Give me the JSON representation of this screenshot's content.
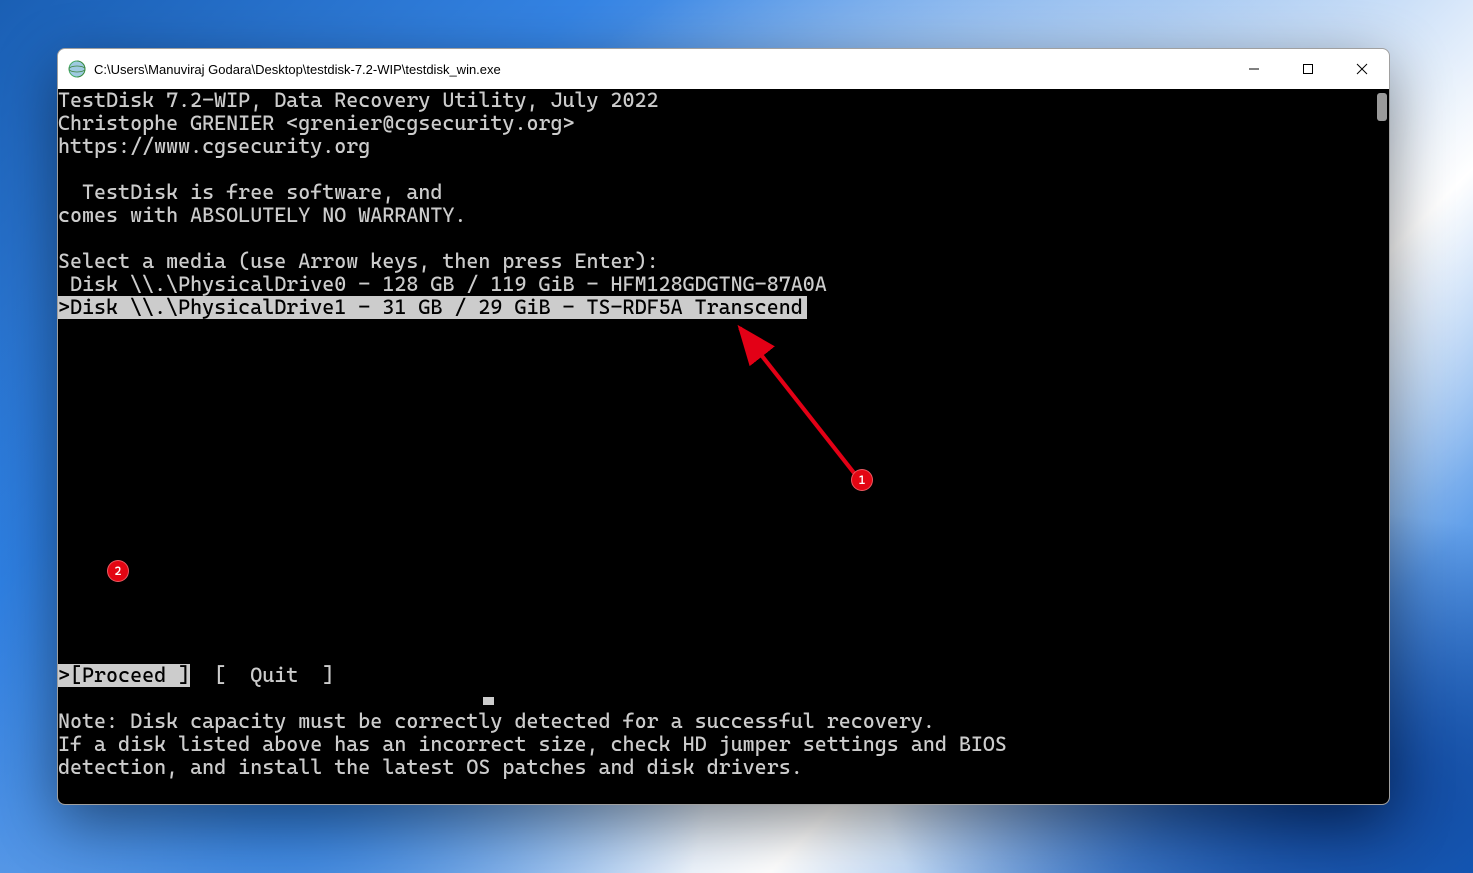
{
  "window": {
    "title": "C:\\Users\\Manuviraj Godara\\Desktop\\testdisk-7.2-WIP\\testdisk_win.exe"
  },
  "terminal": {
    "header1": "TestDisk 7.2-WIP, Data Recovery Utility, July 2022",
    "header2": "Christophe GRENIER <grenier@cgsecurity.org>",
    "header3": "https://www.cgsecurity.org",
    "free1": "  TestDisk is free software, and",
    "free2": "comes with ABSOLUTELY NO WARRANTY.",
    "select_prompt": "Select a media (use Arrow keys, then press Enter):",
    "disks": [
      {
        "line": " Disk \\\\.\\PhysicalDrive0 - 128 GB / 119 GiB - HFM128GDGTNG-87A0A",
        "selected": false
      },
      {
        "line": ">Disk \\\\.\\PhysicalDrive1 - 31 GB / 29 GiB - TS-RDF5A Transcend",
        "selected": true
      }
    ],
    "menu": {
      "proceed": ">[Proceed ]",
      "quit": "  [  Quit  ]"
    },
    "note1": "Note: Disk capacity must be correctly detected for a successful recovery.",
    "note2": "If a disk listed above has an incorrect size, check HD jumper settings and BIOS",
    "note3": "detection, and install the latest OS patches and disk drivers."
  },
  "annotations": {
    "b1": "1",
    "b2": "2"
  }
}
